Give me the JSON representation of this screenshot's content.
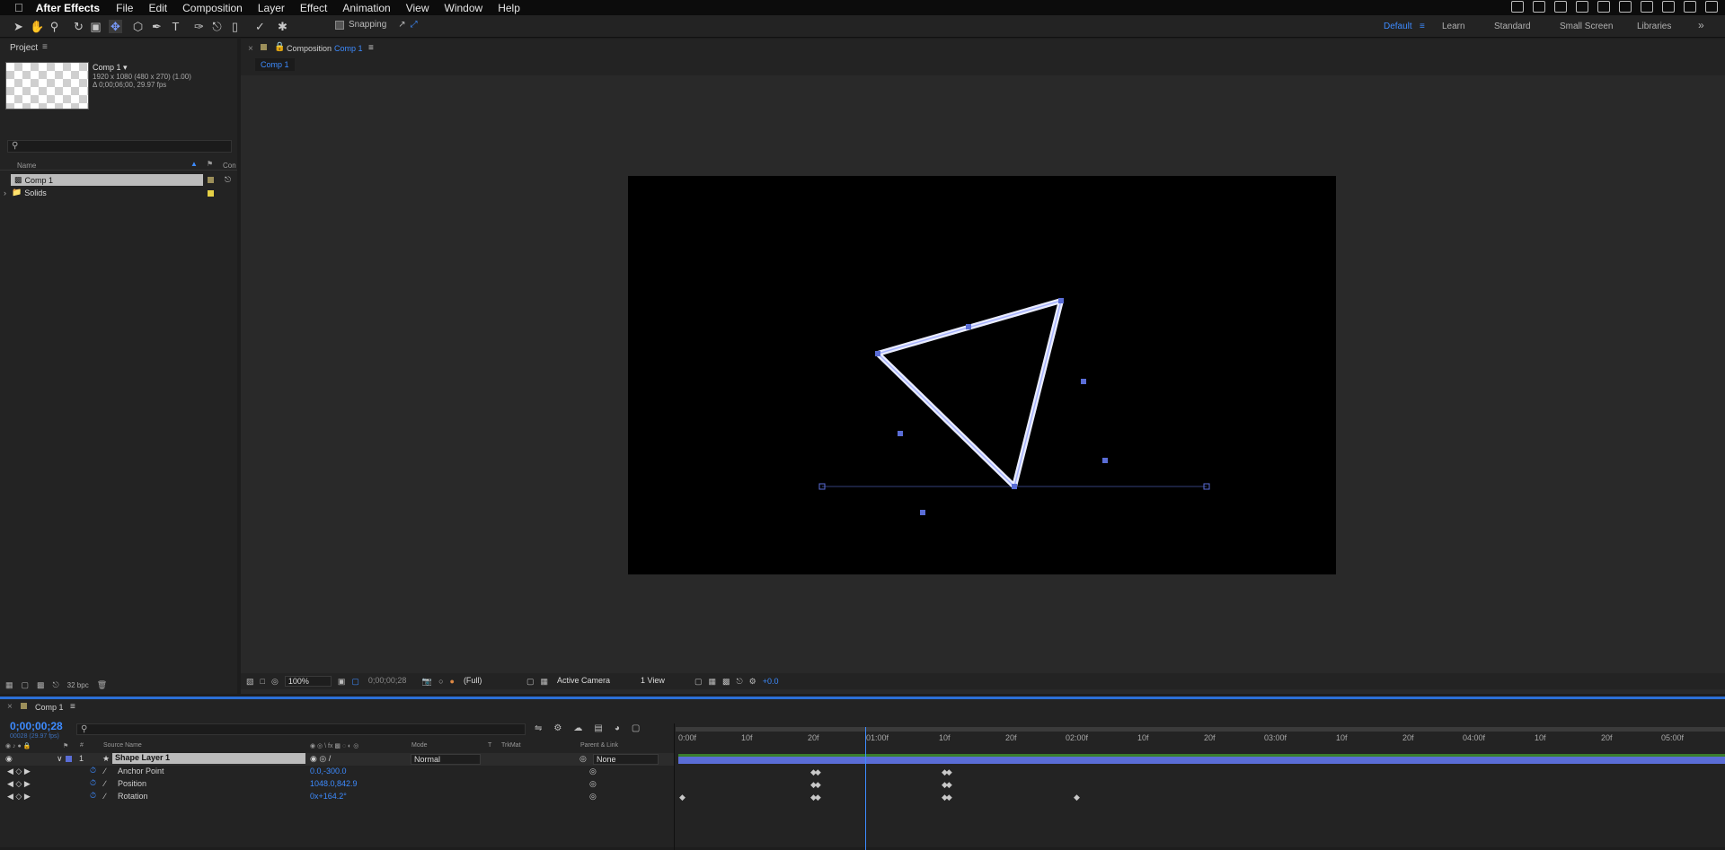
{
  "menubar": {
    "app_name": "After Effects",
    "items": [
      "File",
      "Edit",
      "Composition",
      "Layer",
      "Effect",
      "Animation",
      "View",
      "Window",
      "Help"
    ]
  },
  "toolbar": {
    "snapping_label": "Snapping",
    "workspaces": [
      "Default",
      "Learn",
      "Standard",
      "Small Screen",
      "Libraries"
    ],
    "active_workspace": "Default"
  },
  "project": {
    "title": "Project",
    "comp_name": "Comp 1 ▾",
    "comp_info_1": "1920 x 1080  (480 x 270) (1.00)",
    "comp_info_2": "Δ 0;00;06;00, 29.97 fps",
    "col_name": "Name",
    "col_comment": "Con",
    "items": [
      {
        "name": "Comp 1",
        "label_color": "#9c8f5a"
      },
      {
        "name": "Solids",
        "label_color": "#e5d046"
      }
    ],
    "bpc": "32 bpc"
  },
  "composition": {
    "tab_prefix": "Composition",
    "tab_name": "Comp 1",
    "breadcrumb": "Comp 1",
    "zoom": "100%",
    "timecode": "0;00;00;28",
    "resolution": "(Full)",
    "camera": "Active Camera",
    "views": "1 View",
    "exposure": "+0.0"
  },
  "timeline": {
    "tab_name": "Comp 1",
    "timecode": "0;00;00;28",
    "timecode_sub": "00028 (29.97 fps)",
    "col_source": "Source Name",
    "col_mode": "Mode",
    "col_t": "T",
    "col_trkmat": "TrkMat",
    "col_parent": "Parent & Link",
    "layer": {
      "index": "1",
      "name": "Shape Layer 1",
      "mode": "Normal",
      "parent": "None"
    },
    "properties": [
      {
        "name": "Anchor Point",
        "value": "0.0,-300.0"
      },
      {
        "name": "Position",
        "value": "1048.0,842.9"
      },
      {
        "name": "Rotation",
        "value": "0x+164.2°"
      }
    ],
    "ruler_ticks": [
      "0:00f",
      "10f",
      "20f",
      "01:00f",
      "10f",
      "20f",
      "02:00f",
      "10f",
      "20f",
      "03:00f",
      "10f",
      "20f",
      "04:00f",
      "10f",
      "20f",
      "05:00f"
    ]
  },
  "colors": {
    "accent": "#3d8bff",
    "panel": "#232323",
    "viewer": "#292929"
  }
}
